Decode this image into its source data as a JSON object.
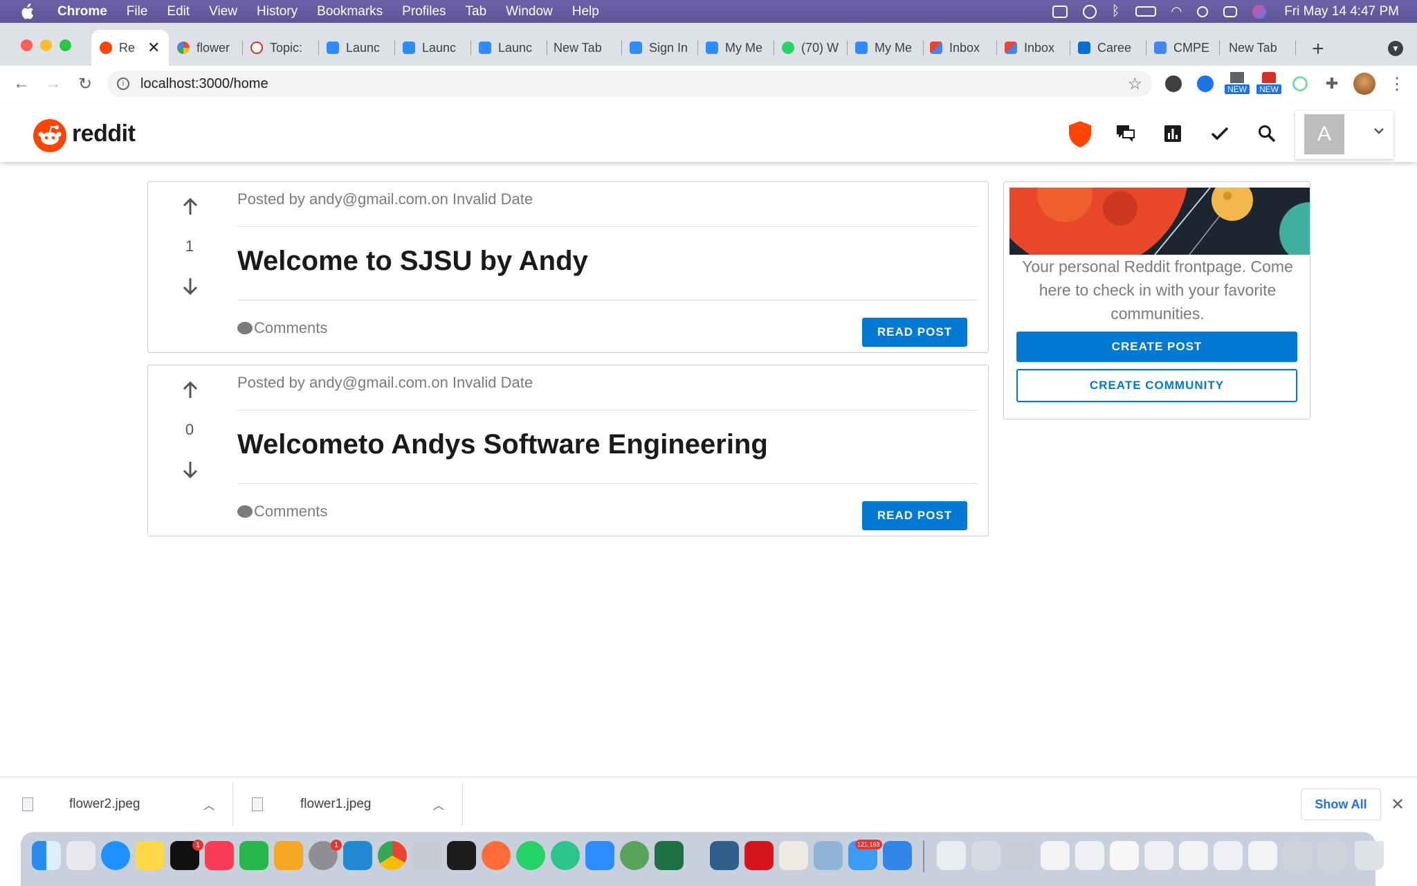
{
  "menubar": {
    "app": "Chrome",
    "items": [
      "File",
      "Edit",
      "View",
      "History",
      "Bookmarks",
      "Profiles",
      "Tab",
      "Window",
      "Help"
    ],
    "datetime": "Fri May 14  4:47 PM"
  },
  "tabs": [
    {
      "label": "Re",
      "active": true
    },
    {
      "label": "flower"
    },
    {
      "label": "Topic:"
    },
    {
      "label": "Launc"
    },
    {
      "label": "Launc"
    },
    {
      "label": "Launc"
    },
    {
      "label": "New Tab"
    },
    {
      "label": "Sign In"
    },
    {
      "label": "My Me"
    },
    {
      "label": "(70) W"
    },
    {
      "label": "My Me"
    },
    {
      "label": "Inbox"
    },
    {
      "label": "Inbox"
    },
    {
      "label": "Caree"
    },
    {
      "label": "CMPE"
    },
    {
      "label": "New Tab"
    }
  ],
  "toolbar": {
    "url": "localhost:3000/home",
    "ext_badge_1": "NEW",
    "ext_badge_2": "NEW"
  },
  "header": {
    "logo_text": "reddit",
    "avatar_letter": "A"
  },
  "posts": [
    {
      "meta": "Posted by andy@gmail.com.on Invalid Date",
      "score": "1",
      "title": "Welcome to SJSU by Andy",
      "comments": "Comments",
      "read_label": "READ POST"
    },
    {
      "meta": "Posted by andy@gmail.com.on Invalid Date",
      "score": "0",
      "title": "Welcometo Andys Software Engineering",
      "comments": "Comments",
      "read_label": "READ POST"
    }
  ],
  "sidebar": {
    "description": "Your personal Reddit frontpage. Come here to check in with your favorite communities.",
    "create_post": "CREATE POST",
    "create_community": "CREATE COMMUNITY"
  },
  "downloads": {
    "items": [
      "flower2.jpeg",
      "flower1.jpeg"
    ],
    "show_all": "Show All"
  },
  "dock": {
    "appletv_badge": "1",
    "settings_badge": "1",
    "mail_badge": "121,168"
  },
  "colors": {
    "reddit_orange": "#ff4500",
    "reddit_blue": "#0079d3",
    "menubar": "#6d62a8"
  }
}
